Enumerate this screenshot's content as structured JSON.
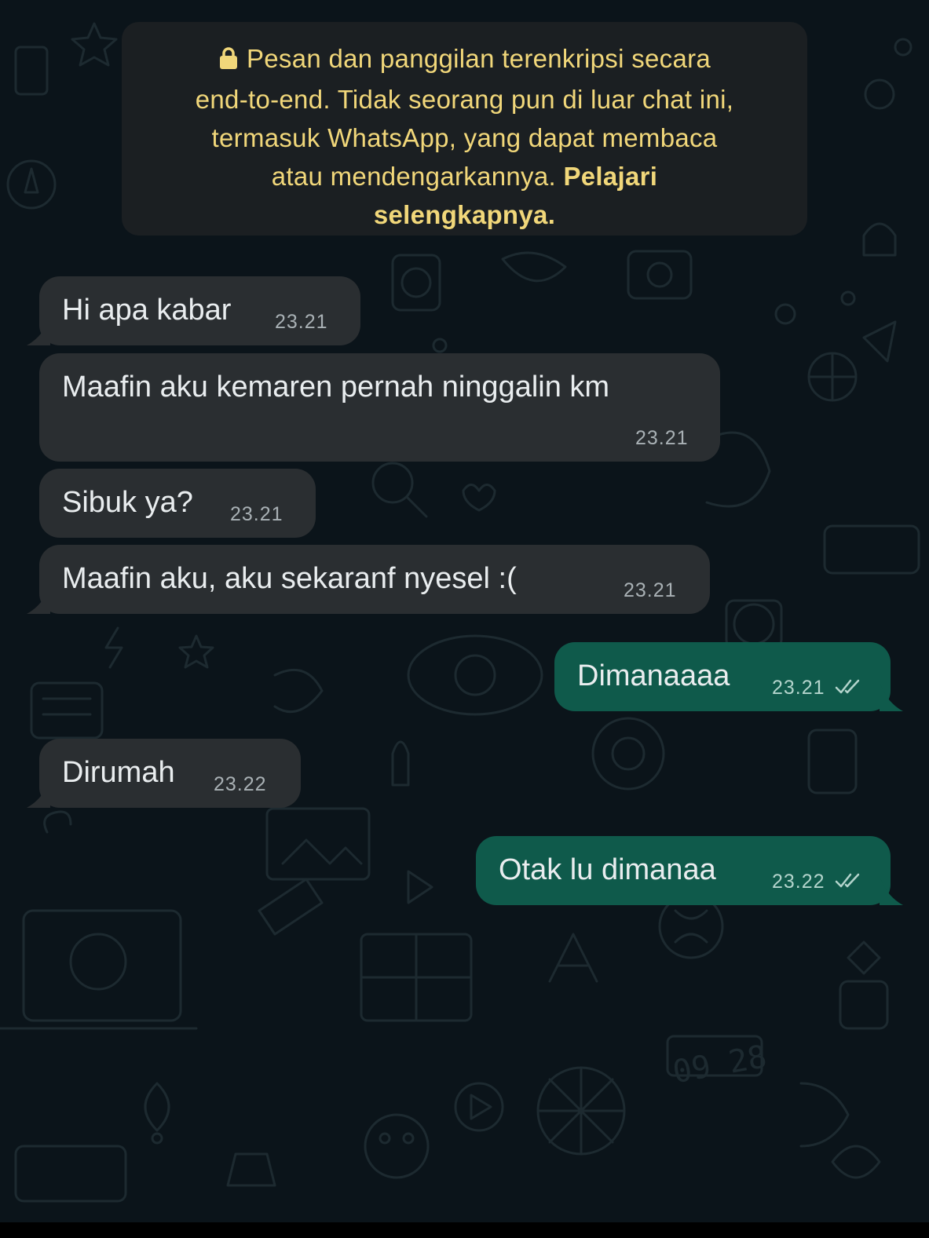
{
  "notice": {
    "icon": "lock-icon",
    "line1": "Pesan dan panggilan terenkripsi secara",
    "line2": "end-to-end. Tidak seorang pun di luar chat ini,",
    "line3": "termasuk WhatsApp, yang dapat membaca",
    "line4": "atau mendengarkannya.",
    "link_part1": "Pelajari",
    "link_part2": "selengkapnya."
  },
  "messages": [
    {
      "direction": "incoming",
      "text": "Hi apa kabar",
      "time": "23.21"
    },
    {
      "direction": "incoming",
      "text": "Maafin aku kemaren pernah ninggalin km",
      "time": "23.21"
    },
    {
      "direction": "incoming",
      "text": "Sibuk ya?",
      "time": "23.21"
    },
    {
      "direction": "incoming",
      "text": "Maafin aku, aku sekaranf nyesel :(",
      "time": "23.21"
    },
    {
      "direction": "outgoing",
      "text": "Dimanaaaa",
      "time": "23.21",
      "status_icon": "double-check-icon"
    },
    {
      "direction": "incoming",
      "text": "Dirumah",
      "time": "23.22"
    },
    {
      "direction": "outgoing",
      "text": "Otak lu dimanaa",
      "time": "23.22",
      "status_icon": "double-check-icon"
    }
  ],
  "colors": {
    "background": "#0b141a",
    "incoming_bubble": "#2a2e31",
    "outgoing_bubble": "#0f5a4b",
    "notice_background": "#1b1f22",
    "notice_text": "#f1d77a",
    "message_text": "#e9edef",
    "timestamp": "#a9b1b5"
  }
}
